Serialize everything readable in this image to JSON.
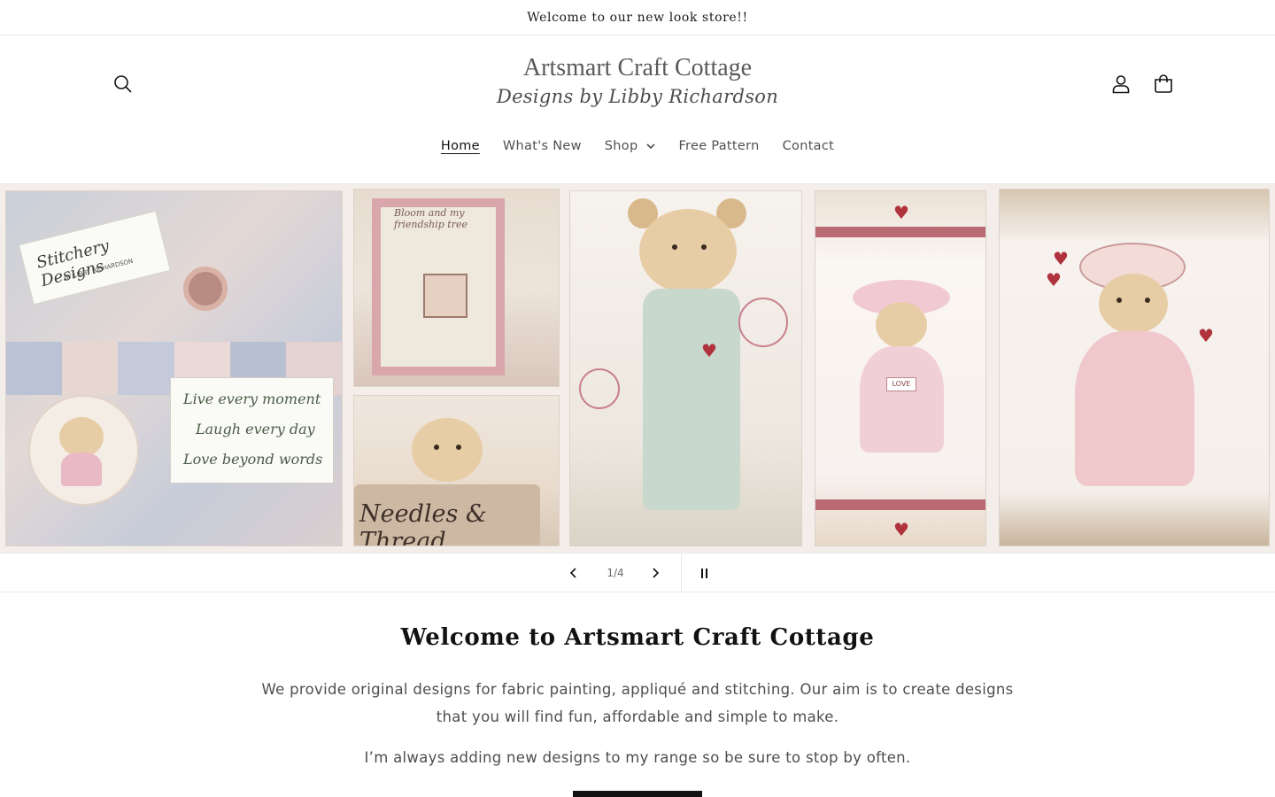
{
  "announcement": {
    "text": "Welcome to our new look store!!"
  },
  "header": {
    "logo_line1": "Artsmart Craft Cottage",
    "logo_line2": "Designs by Libby Richardson",
    "icons": {
      "search": "search-icon",
      "account": "account-icon",
      "cart": "cart-icon"
    }
  },
  "nav": {
    "items": [
      {
        "label": "Home",
        "active": true
      },
      {
        "label": "What's New",
        "active": false
      },
      {
        "label": "Shop",
        "active": false,
        "has_dropdown": true
      },
      {
        "label": "Free Pattern",
        "active": false
      },
      {
        "label": "Contact",
        "active": false
      }
    ]
  },
  "slideshow": {
    "counter": "1/4",
    "current": 1,
    "total": 4,
    "artwork_text": {
      "brand": "Stitchery Designs",
      "brand_sub": "BY LIBBY RICHARDSON",
      "motto": [
        "Live every moment",
        "Laugh every day",
        "Love beyond words"
      ],
      "sampler": "Bloom and my friendship tree",
      "sign": "Needles & Thread",
      "badge": "LOVE"
    }
  },
  "intro": {
    "title": "Welcome to Artsmart Craft Cottage",
    "paragraph1": "We provide original designs for fabric painting, appliqué and stitching. Our aim is to create designs that you will find fun, affordable and simple to make.",
    "paragraph2": "I’m always adding new designs to my range so be sure to stop by often."
  },
  "colors": {
    "text": "#121212",
    "muted": "#4e4e4e",
    "border": "#e8e8e8",
    "accent_red": "#b0323d"
  }
}
